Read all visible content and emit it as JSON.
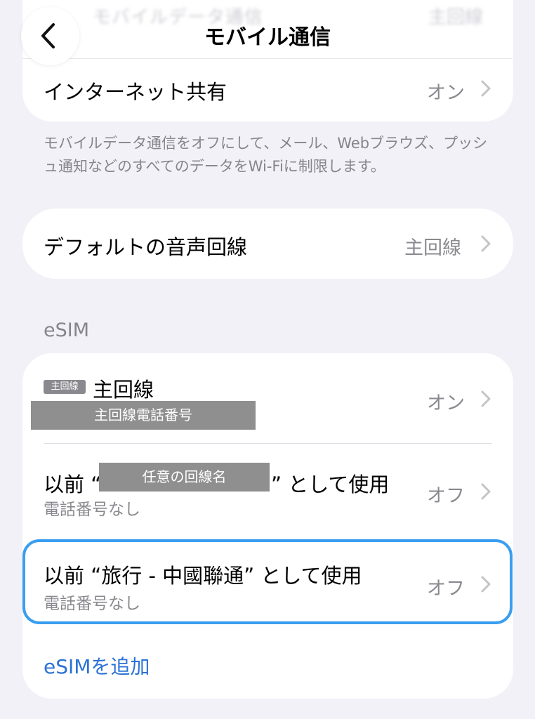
{
  "header": {
    "title": "モバイル通信",
    "behind_label": "モバイルデータ通信",
    "behind_value": "主回線"
  },
  "hotspot": {
    "label": "インターネット共有",
    "value": "オン"
  },
  "footnote": "モバイルデータ通信をオフにして、メール、Webブラウズ、プッシュ通知などのすべてのデータをWi-Fiに制限します。",
  "voice": {
    "label": "デフォルトの音声回線",
    "value": "主回線"
  },
  "esim": {
    "section_label": "eSIM",
    "lines": [
      {
        "badge": "主回線",
        "name": "主回線",
        "redacted_number": "主回線電話番号",
        "value": "オン"
      },
      {
        "prefix": "以前 “",
        "redacted_name": "任意の回線名",
        "suffix": "” として使用",
        "sub": "電話番号なし",
        "value": "オフ"
      },
      {
        "title": "以前 “旅行 - 中國聯通” として使用",
        "sub": "電話番号なし",
        "value": "オフ"
      }
    ],
    "add_label": "eSIMを追加"
  },
  "colors": {
    "background": "#f2f1f7",
    "accent": "#2a72d6",
    "highlight": "#3a9ef0"
  },
  "icons": {
    "back": "chevron-left-icon",
    "disclosure": "chevron-right-icon"
  }
}
